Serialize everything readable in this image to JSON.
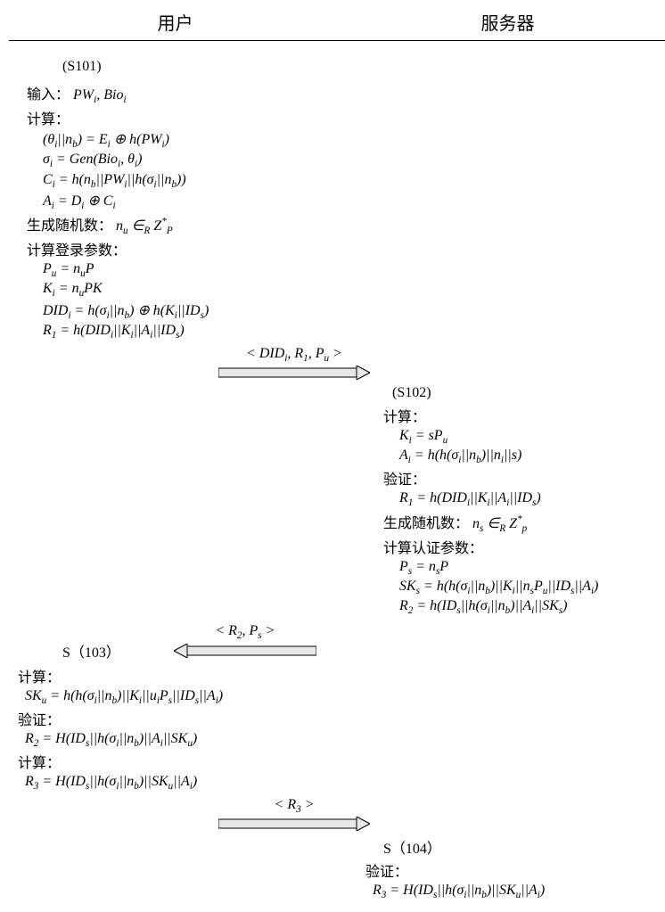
{
  "header": {
    "user": "用户",
    "server": "服务器"
  },
  "s101": {
    "label": "(S101)",
    "input_label": "输入：",
    "input": "PW_i, Bio_i",
    "calc_label": "计算：",
    "eq1": "(θ_i||n_b) = E_i ⊕ h(PW_i)",
    "eq2": "σ_i = Gen(Bio_i, θ_i)",
    "eq3": "C_i = h(n_b||PW_i||h(σ_i||n_b))",
    "eq4": "A_i = D_i ⊕ C_i",
    "rand_label": "生成随机数：",
    "rand": "n_u ∈_R Z_P^*",
    "login_label": "计算登录参数：",
    "l1": "P_u = n_u P",
    "l2": "K_i = n_u PK",
    "l3": "DID_i = h(σ_i||n_b) ⊕ h(K_i||ID_s)",
    "l4": "R_1 = h(DID_i||K_i||A_i||ID_s)",
    "msg": "< DID_i, R_1, P_u >"
  },
  "s102": {
    "label": "(S102)",
    "calc_label": "计算：",
    "c1": "K_i = sP_u",
    "c2": "A_i = h(h(σ_i||n_b)||n_i||s)",
    "verify_label": "验证：",
    "v1": "R_1 = h(DID_i||K_i||A_i||ID_s)",
    "rand_label": "生成随机数：",
    "rand": "n_s ∈_R Z_p^*",
    "auth_label": "计算认证参数：",
    "a1": "P_s = n_s P",
    "a2": "SK_s = h(h(σ_i||n_b)||K_i||n_s P_u||ID_s||A_i)",
    "a3": "R_2 = h(ID_s||h(σ_i||n_b)||A_i||SK_s)",
    "msg": "< R_2, P_s >"
  },
  "s103": {
    "label": "S（103）",
    "calc_label": "计算：",
    "c1": "SK_u = h(h(σ_i||n_b)||K_i||u_i P_s||ID_s||A_i)",
    "verify_label": "验证：",
    "v1": "R_2 = H(ID_s||h(σ_i||n_b)||A_i||SK_u)",
    "calc_label2": "计算：",
    "c2": "R_3 = H(ID_s||h(σ_i||n_b)||SK_u||A_i)",
    "msg": "< R_3 >"
  },
  "s104": {
    "label": "S（104）",
    "verify_label": "验证：",
    "v1": "R_3 = H(ID_s||h(σ_i||n_b)||SK_u||A_i)"
  }
}
